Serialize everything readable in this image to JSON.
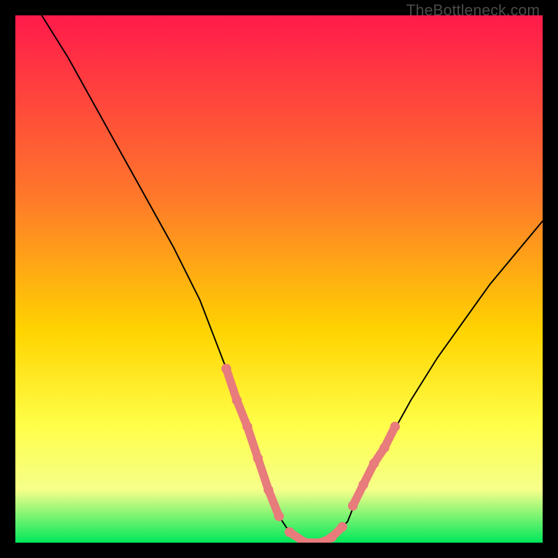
{
  "watermark": "TheBottleneck.com",
  "colors": {
    "gradient_top": "#ff1a4b",
    "gradient_mid1": "#ff7a2a",
    "gradient_mid2": "#ffd400",
    "gradient_mid3": "#ffff4a",
    "gradient_mid4": "#f6ff8a",
    "gradient_bottom": "#00e85a",
    "curve": "#000000",
    "marker": "#e87b7b",
    "frame": "#000000"
  },
  "chart_data": {
    "type": "line",
    "title": "",
    "xlabel": "",
    "ylabel": "",
    "xlim": [
      0,
      100
    ],
    "ylim": [
      0,
      100
    ],
    "grid": false,
    "legend": false,
    "series": [
      {
        "name": "bottleneck-curve",
        "x": [
          5,
          10,
          15,
          20,
          25,
          30,
          35,
          40,
          42,
          45,
          48,
          50,
          52,
          55,
          58,
          60,
          63,
          65,
          70,
          75,
          80,
          85,
          90,
          95,
          100
        ],
        "y": [
          100,
          92,
          83,
          74,
          65,
          56,
          46,
          33,
          27,
          19,
          10,
          5,
          2,
          0,
          0,
          1,
          4,
          9,
          18,
          27,
          35,
          42,
          49,
          55,
          61
        ]
      }
    ],
    "markers": [
      {
        "name": "highlight-segment-left",
        "x": [
          40,
          42,
          44,
          46,
          48,
          50
        ],
        "y": [
          33,
          27,
          22,
          16,
          10,
          5
        ]
      },
      {
        "name": "highlight-segment-bottom",
        "x": [
          52,
          55,
          58,
          60,
          62
        ],
        "y": [
          2,
          0,
          0,
          1,
          3
        ]
      },
      {
        "name": "highlight-segment-right",
        "x": [
          64,
          66,
          68,
          70,
          72
        ],
        "y": [
          7,
          11,
          15,
          18,
          22
        ]
      }
    ]
  }
}
